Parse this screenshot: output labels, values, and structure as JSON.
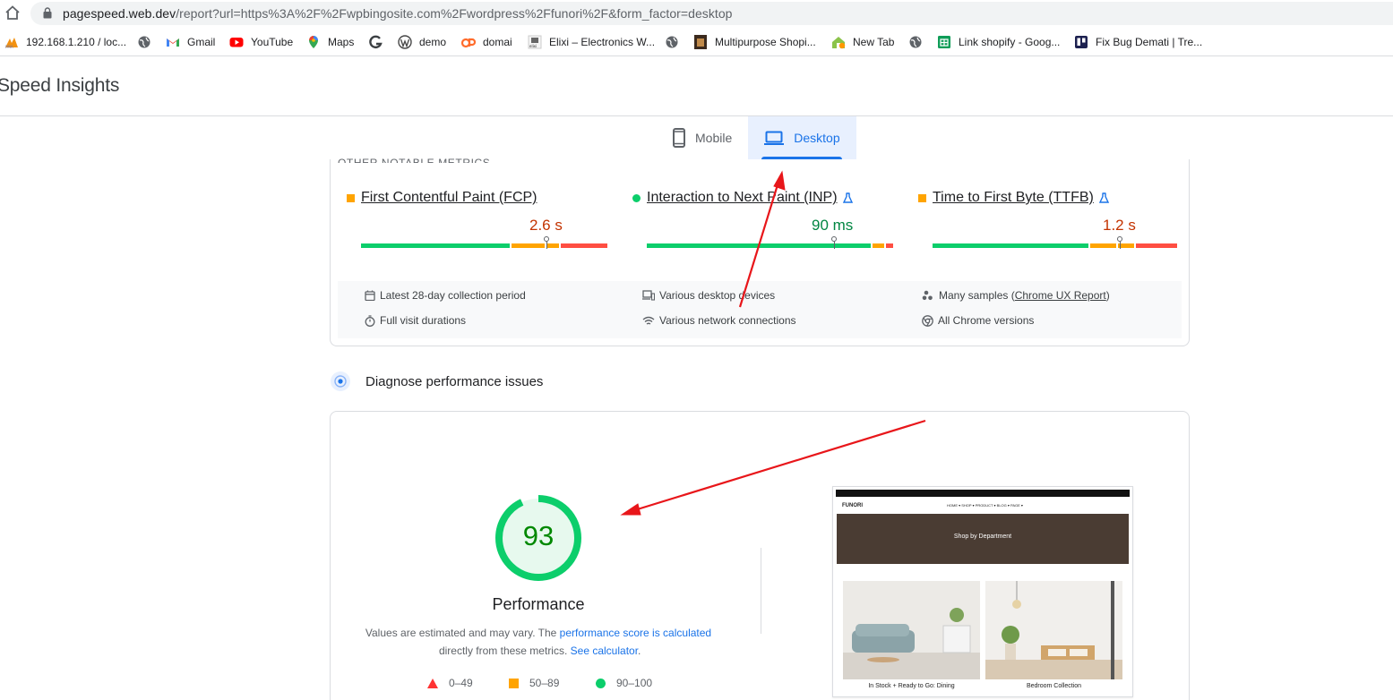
{
  "browser": {
    "url_host": "pagespeed.web.dev",
    "url_path": "/report?url=https%3A%2F%2Fwpbingosite.com%2Fwordpress%2Ffunori%2F&form_factor=desktop",
    "bookmarks": [
      {
        "label": "192.168.1.210 / loc...",
        "icon": "phpmyadmin-icon"
      },
      {
        "label": "",
        "icon": "globe-icon"
      },
      {
        "label": "Gmail",
        "icon": "gmail-icon"
      },
      {
        "label": "YouTube",
        "icon": "youtube-icon"
      },
      {
        "label": "Maps",
        "icon": "maps-icon"
      },
      {
        "label": "",
        "icon": "g-logo-icon"
      },
      {
        "label": "demo",
        "icon": "wordpress-icon"
      },
      {
        "label": "domai",
        "icon": "cpanel-icon"
      },
      {
        "label": "Elixi – Electronics W...",
        "icon": "elixi-icon"
      },
      {
        "label": "",
        "icon": "globe-icon"
      },
      {
        "label": "Multipurpose Shopi...",
        "icon": "shop-thumbnail-icon"
      },
      {
        "label": "New Tab",
        "icon": "new-tab-icon"
      },
      {
        "label": "",
        "icon": "globe-icon"
      },
      {
        "label": "Link shopify - Goog...",
        "icon": "google-sheets-icon"
      },
      {
        "label": "Fix Bug Demati | Tre...",
        "icon": "trello-icon"
      }
    ]
  },
  "site": {
    "title": "Speed Insights"
  },
  "tabs": [
    {
      "label": "Mobile",
      "icon": "phone-icon",
      "active": false
    },
    {
      "label": "Desktop",
      "icon": "laptop-icon",
      "active": true
    }
  ],
  "crux": {
    "section_label": "OTHER NOTABLE METRICS",
    "metrics": [
      {
        "name": "First Contentful Paint (FCP)",
        "value": "2.6 s",
        "status": "average",
        "experimental": false,
        "marker_fraction": 0.73
      },
      {
        "name": "Interaction to Next Paint (INP)",
        "value": "90 ms",
        "status": "good",
        "experimental": true,
        "marker_fraction": 0.75
      },
      {
        "name": "Time to First Byte (TTFB)",
        "value": "1.2 s",
        "status": "average",
        "experimental": true,
        "marker_fraction": 0.75
      }
    ],
    "info": {
      "period": "Latest 28-day collection period",
      "duration": "Full visit durations",
      "devices": "Various desktop devices",
      "network": "Various network connections",
      "samples_prefix": "Many samples (",
      "samples_link": "Chrome UX Report",
      "samples_suffix": ")",
      "versions": "All Chrome versions"
    }
  },
  "diagnose": {
    "title": "Diagnose performance issues"
  },
  "performance": {
    "score": "93",
    "score_fraction": 0.93,
    "label": "Performance",
    "desc_1": "Values are estimated and may vary. The ",
    "desc_link_1": "performance score is calculated",
    "desc_2": " directly from these metrics. ",
    "desc_link_2": "See calculator",
    "desc_3": ".",
    "legend": [
      {
        "range": "0–49",
        "shape": "triangle",
        "color": "#ff3333"
      },
      {
        "range": "50–89",
        "shape": "square",
        "color": "#ffa400"
      },
      {
        "range": "90–100",
        "shape": "circle",
        "color": "#0cce6b"
      }
    ]
  },
  "thumbnail": {
    "brand": "FUNORI",
    "nav": "HOME ▾   SHOP ▾   PRODUCT ▾   BLOG ▾   PAGE ▾",
    "banner": "Shop by Department",
    "caption_1": "In Stock + Ready to Go: Dining",
    "caption_2": "Bedroom Collection"
  },
  "colors": {
    "good": "#0cce6b",
    "average": "#ffa400",
    "poor": "#ff4e42",
    "accent": "#1a73e8",
    "annotation": "#e8161a"
  }
}
